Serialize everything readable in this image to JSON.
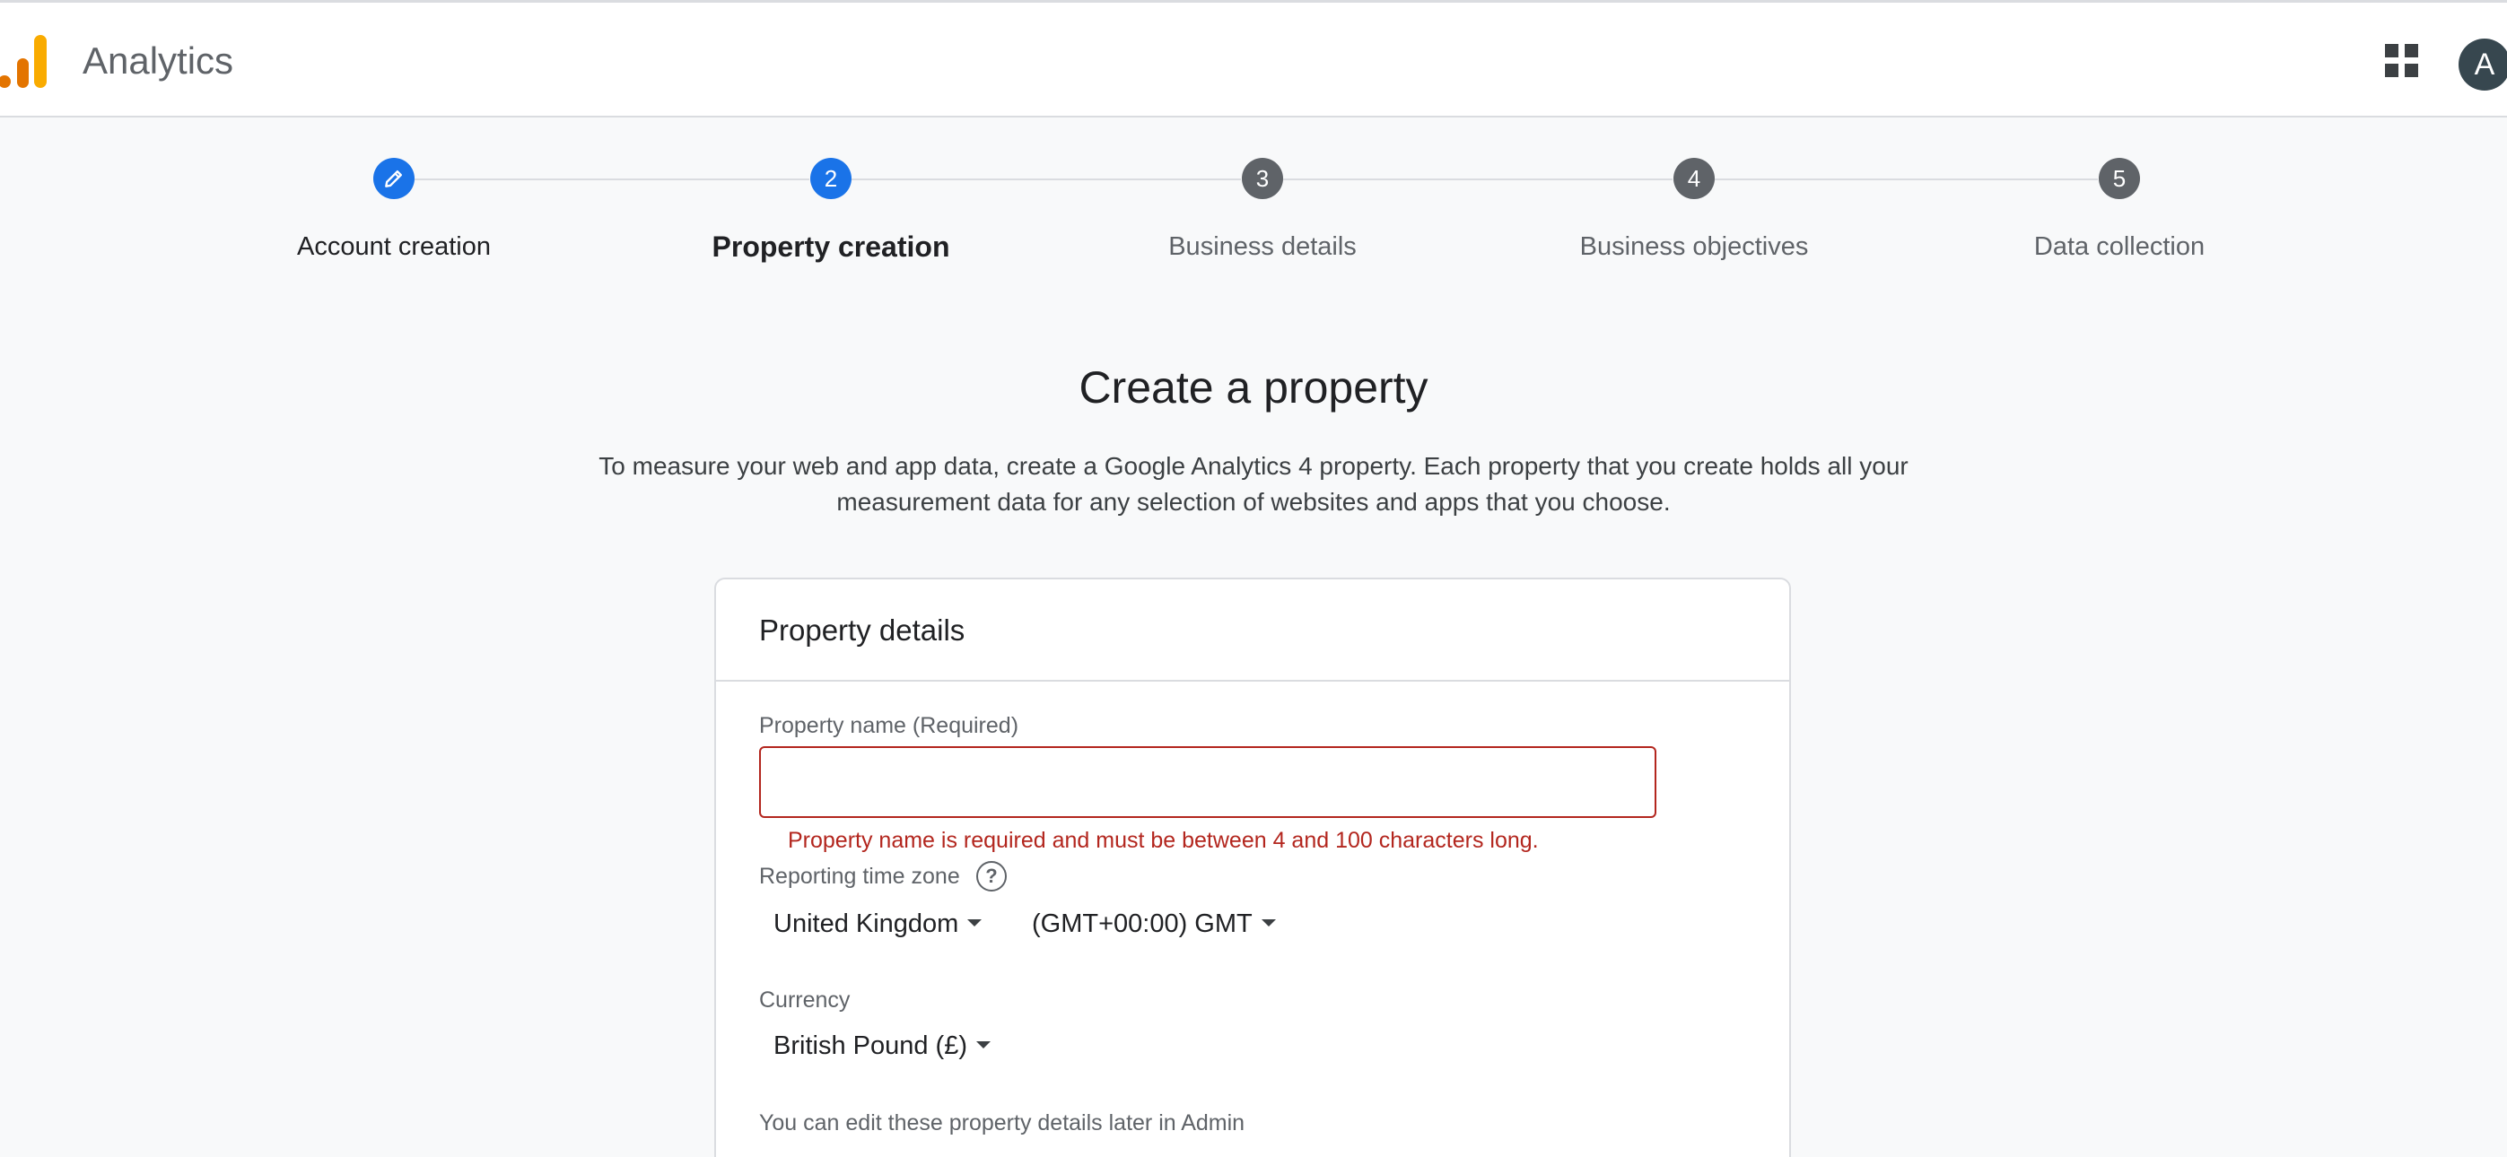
{
  "header": {
    "app_title": "Analytics",
    "logo_icon": "analytics-bars-icon",
    "apps_icon": "apps-grid-icon",
    "avatar_initial": "A"
  },
  "stepper": {
    "steps": [
      {
        "label": "Account creation",
        "state": "done",
        "icon": "pencil-icon"
      },
      {
        "label": "Property creation",
        "state": "current",
        "number": "2"
      },
      {
        "label": "Business details",
        "state": "pending",
        "number": "3"
      },
      {
        "label": "Business objectives",
        "state": "pending",
        "number": "4"
      },
      {
        "label": "Data collection",
        "state": "pending",
        "number": "5"
      }
    ]
  },
  "main": {
    "title": "Create a property",
    "description_line1": "To measure your web and app data, create a Google Analytics 4 property. Each property that you create holds all your",
    "description_line2": "measurement data for any selection of websites and apps that you choose."
  },
  "property_details": {
    "card_title": "Property details",
    "name_label": "Property name (Required)",
    "name_value": "",
    "name_error": "Property name is required and must be between 4 and 100 characters long.",
    "timezone_label": "Reporting time zone",
    "timezone_help_icon": "help-circle-icon",
    "country_value": "United Kingdom",
    "timezone_value": "(GMT+00:00) GMT",
    "currency_label": "Currency",
    "currency_value": "British Pound (£)",
    "note": "You can edit these property details later in Admin"
  },
  "colors": {
    "accent": "#1a73e8",
    "error": "#b3261e",
    "step_inactive": "#5f6368",
    "logo_orange": "#f9ab00",
    "logo_dark_orange": "#e37400"
  }
}
